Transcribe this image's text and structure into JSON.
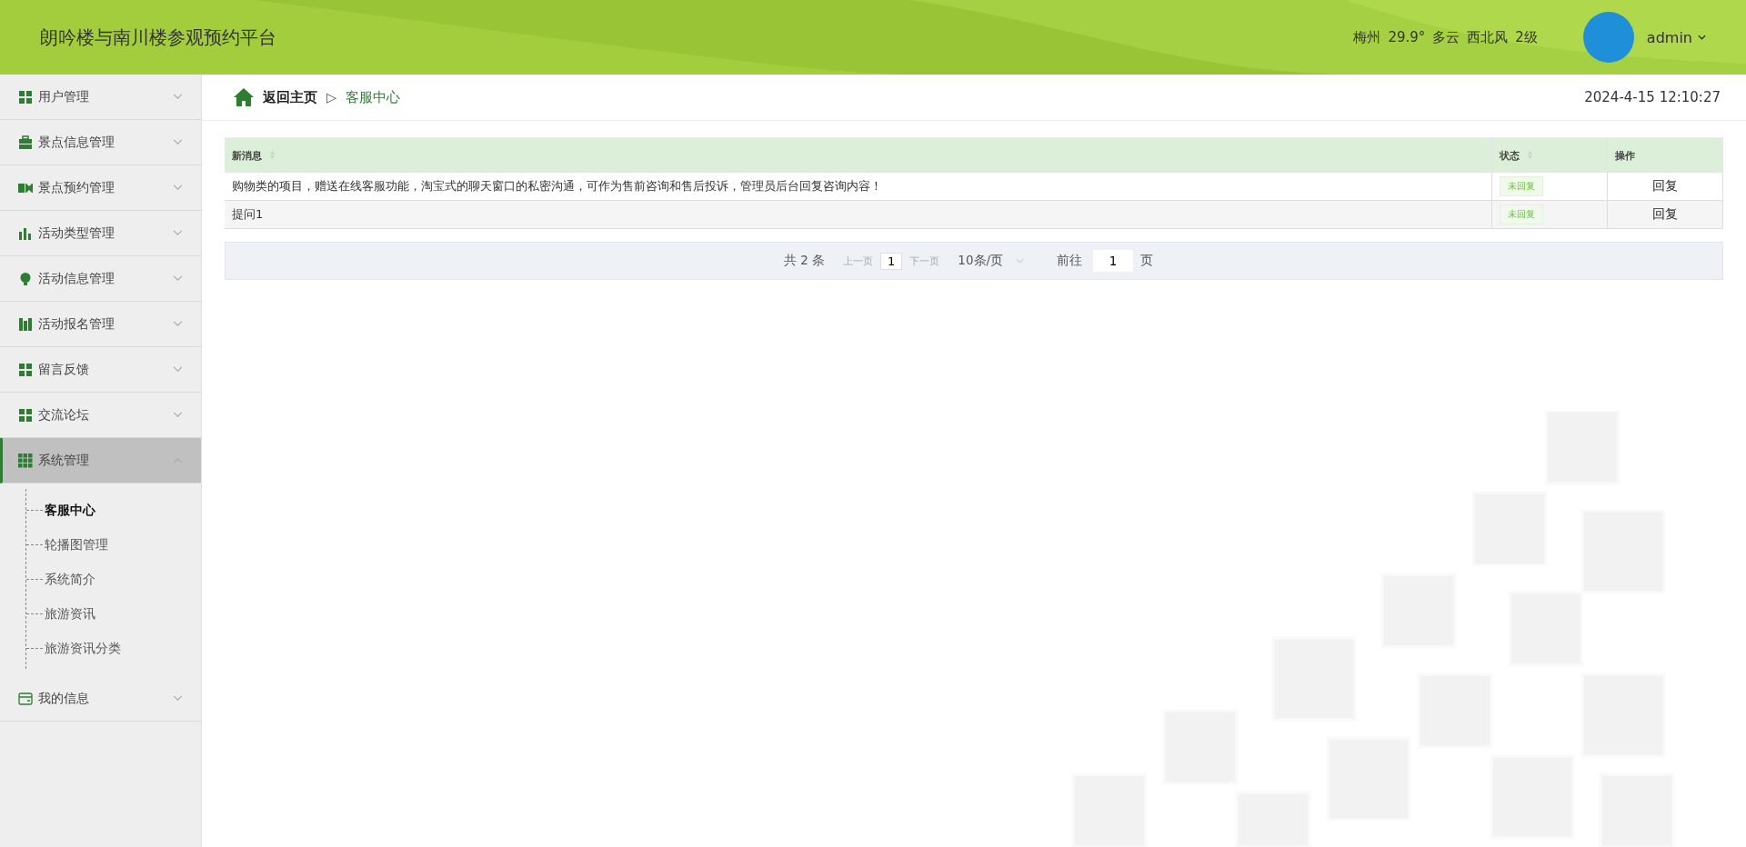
{
  "header": {
    "title": "朗吟楼与南川楼参观预约平台",
    "weather": [
      "梅州",
      "29.9°",
      "多云",
      "西北风",
      "2级"
    ],
    "user": "admin"
  },
  "sidebar": {
    "items": [
      {
        "label": "用户管理",
        "selected": false,
        "expanded": false
      },
      {
        "label": "景点信息管理",
        "selected": false,
        "expanded": false
      },
      {
        "label": "景点预约管理",
        "selected": false,
        "expanded": false
      },
      {
        "label": "活动类型管理",
        "selected": false,
        "expanded": false
      },
      {
        "label": "活动信息管理",
        "selected": false,
        "expanded": false
      },
      {
        "label": "活动报名管理",
        "selected": false,
        "expanded": false
      },
      {
        "label": "留言反馈",
        "selected": false,
        "expanded": false
      },
      {
        "label": "交流论坛",
        "selected": false,
        "expanded": false
      },
      {
        "label": "系统管理",
        "selected": true,
        "expanded": true,
        "children": [
          {
            "label": "客服中心",
            "selected": true
          },
          {
            "label": "轮播图管理",
            "selected": false
          },
          {
            "label": "系统简介",
            "selected": false
          },
          {
            "label": "旅游资讯",
            "selected": false
          },
          {
            "label": "旅游资讯分类",
            "selected": false
          }
        ]
      },
      {
        "label": "我的信息",
        "selected": false,
        "expanded": false
      }
    ]
  },
  "breadcrumb": {
    "home": "返回主页",
    "separator": "▷",
    "current": "客服中心",
    "datetime": "2024-4-15 12:10:27"
  },
  "table": {
    "columns": [
      "新消息",
      "状态",
      "操作"
    ],
    "rows": [
      {
        "message": "购物类的项目，赠送在线客服功能，淘宝式的聊天窗口的私密沟通，可作为售前咨询和售后投诉，管理员后台回复咨询内容！",
        "status": "未回复",
        "action": "回复"
      },
      {
        "message": "提问1",
        "status": "未回复",
        "action": "回复"
      }
    ]
  },
  "pagination": {
    "total": "共 2 条",
    "prev": "上一页",
    "page": "1",
    "next": "下一页",
    "size": "10条/页",
    "goto": "前往",
    "goto_value": "1",
    "goto_unit": "页"
  }
}
